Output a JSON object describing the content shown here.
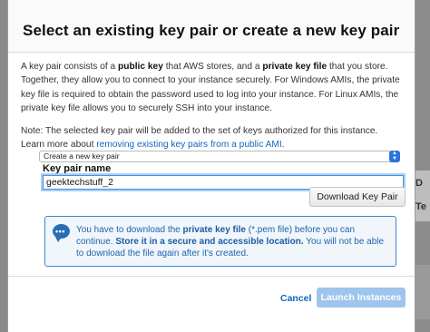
{
  "dialog": {
    "title": "Select an existing key pair or create a new key pair"
  },
  "intro": {
    "t1": "A key pair consists of a ",
    "b1": "public key",
    "t2": " that AWS stores, and a ",
    "b2": "private key file",
    "t3": " that you store. Together, they allow you to connect to your instance securely. For Windows AMIs, the private key file is required to obtain the password used to log into your instance. For Linux AMIs, the private key file allows you to securely SSH into your instance."
  },
  "note": {
    "text": "Note: The selected key pair will be added to the set of keys authorized for this instance. Learn more about ",
    "link": "removing existing key pairs from a public AMI",
    "end": "."
  },
  "keypair_select": {
    "selected": "Create a new key pair"
  },
  "keypair_name": {
    "label": "Key pair name",
    "value": "geektechstuff_2"
  },
  "download_button": "Download Key Pair",
  "info": {
    "t1": "You have to download the ",
    "b1": "private key file",
    "t2": " (*.pem file) before you can continue. ",
    "b2": "Store it in a secure and accessible location.",
    "t3": " You will not be able to download the file again after it's created."
  },
  "footer": {
    "cancel": "Cancel",
    "launch": "Launch Instances"
  },
  "background": {
    "right_text_1": "D",
    "right_text_2": "Te"
  },
  "colors": {
    "link": "#1166bb",
    "info_border": "#3b86d1",
    "primary_disabled": "#9ec5ec"
  }
}
